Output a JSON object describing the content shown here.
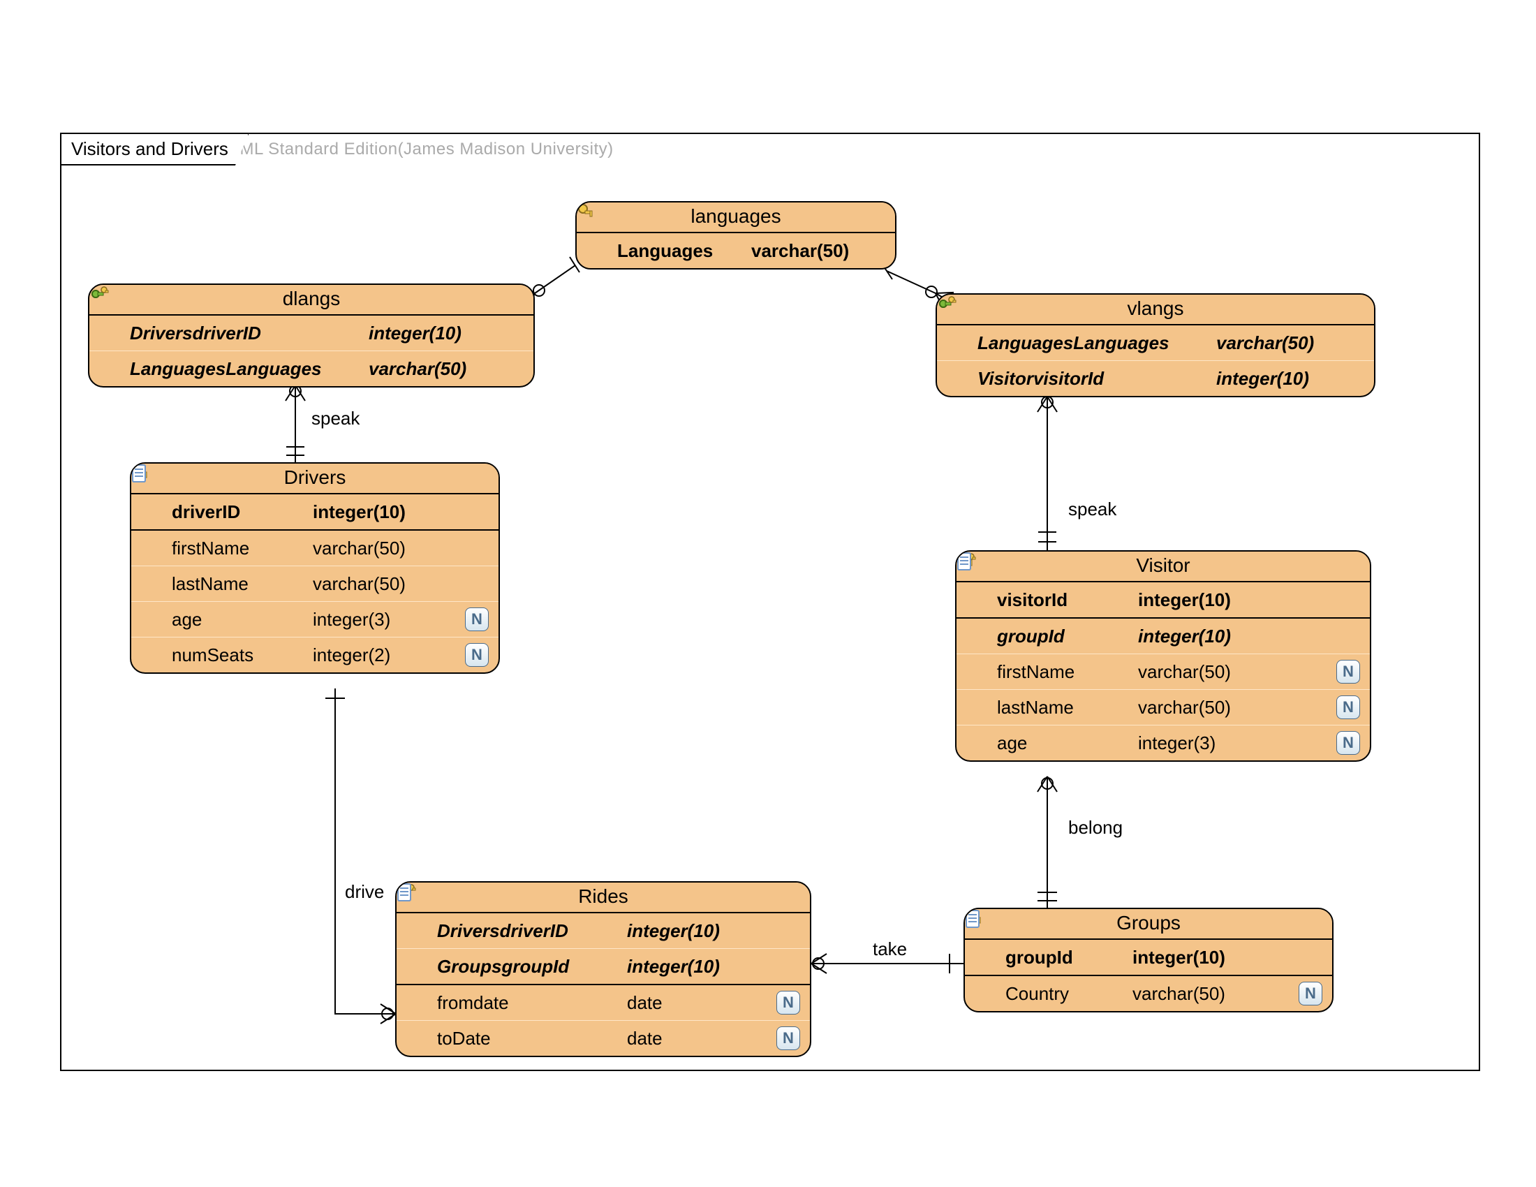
{
  "watermark": "Visual Paradigm for UML Standard Edition(James Madison University)",
  "frame_title": "Visitors and Drivers",
  "icons": {
    "pk": "primary-key-icon",
    "fk": "foreign-key-icon",
    "col": "column-icon",
    "nul": "N"
  },
  "relations": {
    "speak1": "speak",
    "speak2": "speak",
    "drive": "drive",
    "take": "take",
    "belong": "belong"
  },
  "entities": {
    "languages": {
      "title": "languages",
      "rows": [
        {
          "icon": "pk",
          "name": "Languages",
          "type": "varchar(50)",
          "bold": true
        }
      ]
    },
    "dlangs": {
      "title": "dlangs",
      "rows": [
        {
          "icon": "fk",
          "name": "DriversdriverID",
          "type": "integer(10)",
          "bi": true
        },
        {
          "icon": "fk",
          "name": "LanguagesLanguages",
          "type": "varchar(50)",
          "bi": true
        }
      ]
    },
    "vlangs": {
      "title": "vlangs",
      "rows": [
        {
          "icon": "fk",
          "name": "LanguagesLanguages",
          "type": "varchar(50)",
          "bi": true
        },
        {
          "icon": "fk",
          "name": "VisitorvisitorId",
          "type": "integer(10)",
          "bi": true
        }
      ]
    },
    "drivers": {
      "title": "Drivers",
      "rows": [
        {
          "icon": "pk",
          "name": "driverID",
          "type": "integer(10)",
          "bold": true
        },
        {
          "icon": "col",
          "name": "firstName",
          "type": "varchar(50)",
          "sep": true
        },
        {
          "icon": "col",
          "name": "lastName",
          "type": "varchar(50)"
        },
        {
          "icon": "col",
          "name": "age",
          "type": "integer(3)",
          "nul": true
        },
        {
          "icon": "col",
          "name": "numSeats",
          "type": "integer(2)",
          "nul": true
        }
      ]
    },
    "visitor": {
      "title": "Visitor",
      "rows": [
        {
          "icon": "pk",
          "name": "visitorId",
          "type": "integer(10)",
          "bold": true
        },
        {
          "icon": "fk",
          "name": "groupId",
          "type": "integer(10)",
          "bi": true,
          "sep": true
        },
        {
          "icon": "col",
          "name": "firstName",
          "type": "varchar(50)",
          "nul": true
        },
        {
          "icon": "col",
          "name": "lastName",
          "type": "varchar(50)",
          "nul": true
        },
        {
          "icon": "col",
          "name": "age",
          "type": "integer(3)",
          "nul": true
        }
      ]
    },
    "rides": {
      "title": "Rides",
      "rows": [
        {
          "icon": "fk",
          "name": "DriversdriverID",
          "type": "integer(10)",
          "bi": true
        },
        {
          "icon": "fk",
          "name": "GroupsgroupId",
          "type": "integer(10)",
          "bi": true
        },
        {
          "icon": "col",
          "name": "fromdate",
          "type": "date",
          "nul": true,
          "sep": true
        },
        {
          "icon": "col",
          "name": "toDate",
          "type": "date",
          "nul": true
        }
      ]
    },
    "groups": {
      "title": "Groups",
      "rows": [
        {
          "icon": "pk",
          "name": "groupId",
          "type": "integer(10)",
          "bold": true
        },
        {
          "icon": "col",
          "name": "Country",
          "type": "varchar(50)",
          "nul": true,
          "sep": true
        }
      ]
    }
  }
}
